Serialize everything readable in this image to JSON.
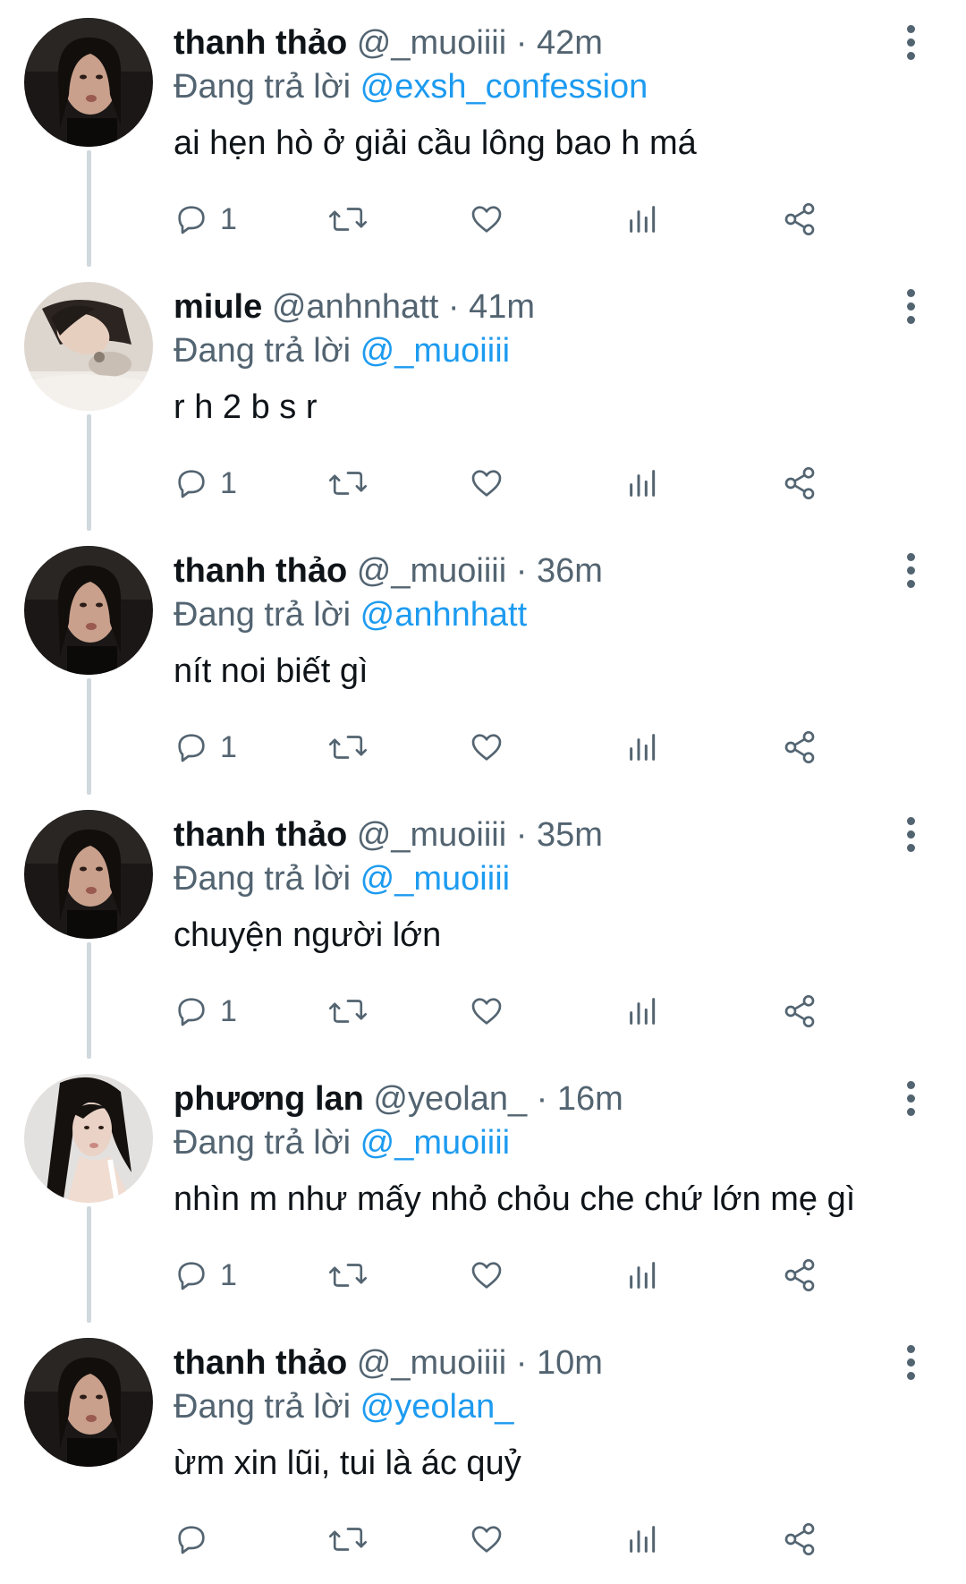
{
  "reply_prefix": "Đang trả lời",
  "tweets": [
    {
      "name": "thanh thảo",
      "handle": "@_muoiiii",
      "sep": "·",
      "time": "42m",
      "reply_to": "@exsh_confession",
      "text": "ai hẹn hò ở giải cầu lông bao h má",
      "reply_count": "1"
    },
    {
      "name": "miule",
      "handle": "@anhnhatt",
      "sep": "·",
      "time": "41m",
      "reply_to": "@_muoiiii",
      "text": "r h 2 b s r",
      "reply_count": "1"
    },
    {
      "name": "thanh thảo",
      "handle": "@_muoiiii",
      "sep": "·",
      "time": "36m",
      "reply_to": "@anhnhatt",
      "text": "nít noi biết gì",
      "reply_count": "1"
    },
    {
      "name": "thanh thảo",
      "handle": "@_muoiiii",
      "sep": "·",
      "time": "35m",
      "reply_to": "@_muoiiii",
      "text": "chuyện người lớn",
      "reply_count": "1"
    },
    {
      "name": "phương lan",
      "handle": "@yeolan_",
      "sep": "·",
      "time": "16m",
      "reply_to": "@_muoiiii",
      "text": "nhìn m như mấy nhỏ chỏu che chứ lớn mẹ gì",
      "reply_count": "1"
    },
    {
      "name": "thanh thảo",
      "handle": "@_muoiiii",
      "sep": "·",
      "time": "10m",
      "reply_to": "@yeolan_",
      "text": "ừm xin lũi, tui là ác quỷ",
      "reply_count": ""
    }
  ],
  "icons": {
    "reply": "reply-icon",
    "retweet": "retweet-icon",
    "like": "heart-icon",
    "views": "views-icon",
    "share": "share-icon",
    "more": "more-icon"
  },
  "colors": {
    "mention": "#1d9bf0",
    "secondary_text": "#536471",
    "primary_text": "#0f1419",
    "thread_line": "#cfd9de"
  }
}
